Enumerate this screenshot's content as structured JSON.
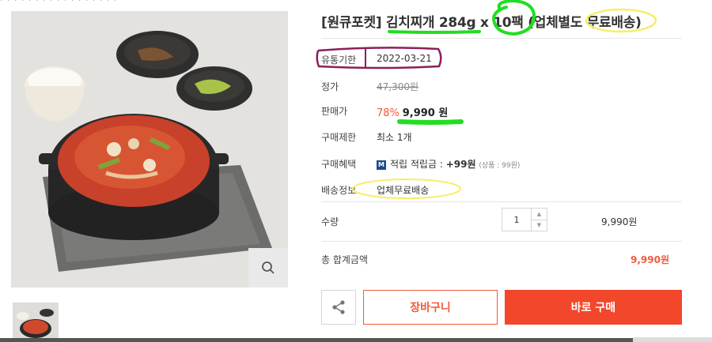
{
  "breadcrumb": "· · · · · · · ·  · · · · · · · · ·",
  "product": {
    "title": "[원큐포켓] 김치찌개 284g x 10팩 (업체별도 무료배송)",
    "expiry_label": "유통기한",
    "expiry_value": "2022-03-21",
    "list_price_label": "정가",
    "list_price": "47,300원",
    "sale_price_label": "판매가",
    "discount": "78%",
    "sale_price": "9,990 원",
    "purchase_limit_label": "구매제한",
    "purchase_limit": "최소 1개",
    "benefit_label": "구매혜택",
    "benefit_badge": "M",
    "benefit_text": "적립 적립금 :",
    "benefit_points": "+99원",
    "benefit_note": "(상품 : 99원)",
    "shipping_label": "배송정보",
    "shipping_value": "업체무료배송",
    "quantity_label": "수량",
    "quantity_value": "1",
    "quantity_price": "9,990원",
    "total_label": "총 합계금액",
    "total_value": "9,990원"
  },
  "actions": {
    "cart_label": "장바구니",
    "buy_label": "바로 구매"
  },
  "icons": {
    "zoom": "search-icon",
    "share": "share-icon",
    "qty_up": "chevron-up-icon",
    "qty_down": "chevron-down-icon"
  },
  "colors": {
    "accent": "#f2472b",
    "discount": "#f15a3a",
    "highlight_green": "#22dd22",
    "highlight_yellow": "#f5ee6a",
    "highlight_purple": "#8b1f5c"
  }
}
